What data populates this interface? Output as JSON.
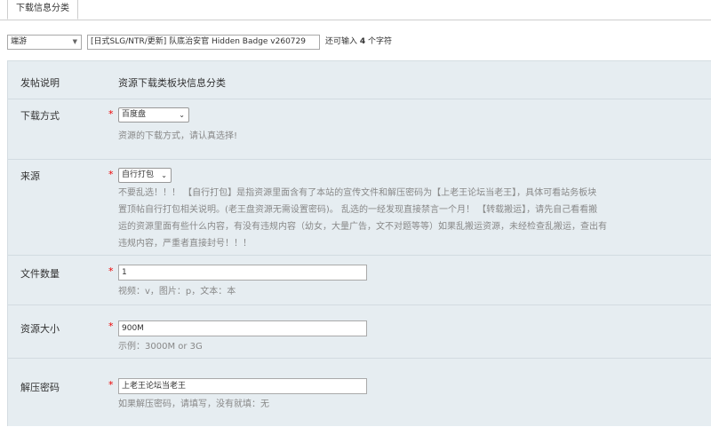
{
  "tabs": [
    {
      "label": "下载信息分类"
    }
  ],
  "title_row": {
    "category": "端游",
    "title_value": "[日式SLG/NTR/更新] 队底治安官 Hidden Badge v260729",
    "remaining_prefix": "还可输入",
    "remaining_count": "4",
    "remaining_suffix": "个字符"
  },
  "form": {
    "post_note": {
      "label": "发帖说明",
      "value": "资源下载类板块信息分类"
    },
    "download_method": {
      "label": "下载方式",
      "required": "*",
      "selected": "百度盘",
      "description": "资源的下载方式，请认真选择!"
    },
    "source": {
      "label": "来源",
      "required": "*",
      "selected": "自行打包",
      "description": [
        "不要乱选！！！ 【自行打包】是指资源里面含有了本站的宣传文件和解压密码为【上老王论坛当老王】，具体可看站务板块",
        "置顶帖自行打包相关说明。(老王盘资源无需设置密码)。 乱选的一经发现直接禁言一个月！ 【转载搬运】，请先自己看看搬",
        "运的资源里面有些什么内容，有没有违规内容（幼女，大量广告，文不对题等等）如果乱搬运资源，未经检查乱搬运，查出有",
        "违规内容，严重者直接封号！！！"
      ]
    },
    "file_count": {
      "label": "文件数量",
      "required": "*",
      "value": "1",
      "description": "视频：v，图片：p，文本：本"
    },
    "resource_size": {
      "label": "资源大小",
      "required": "*",
      "value": "900M",
      "description": "示例：3000M or 3G"
    },
    "unzip_password": {
      "label": "解压密码",
      "required": "*",
      "value": "上老王论坛当老王",
      "description": "如果解压密码，请填写，没有就填：无"
    }
  },
  "icons": {
    "dropdown": "chevron-down-icon"
  }
}
